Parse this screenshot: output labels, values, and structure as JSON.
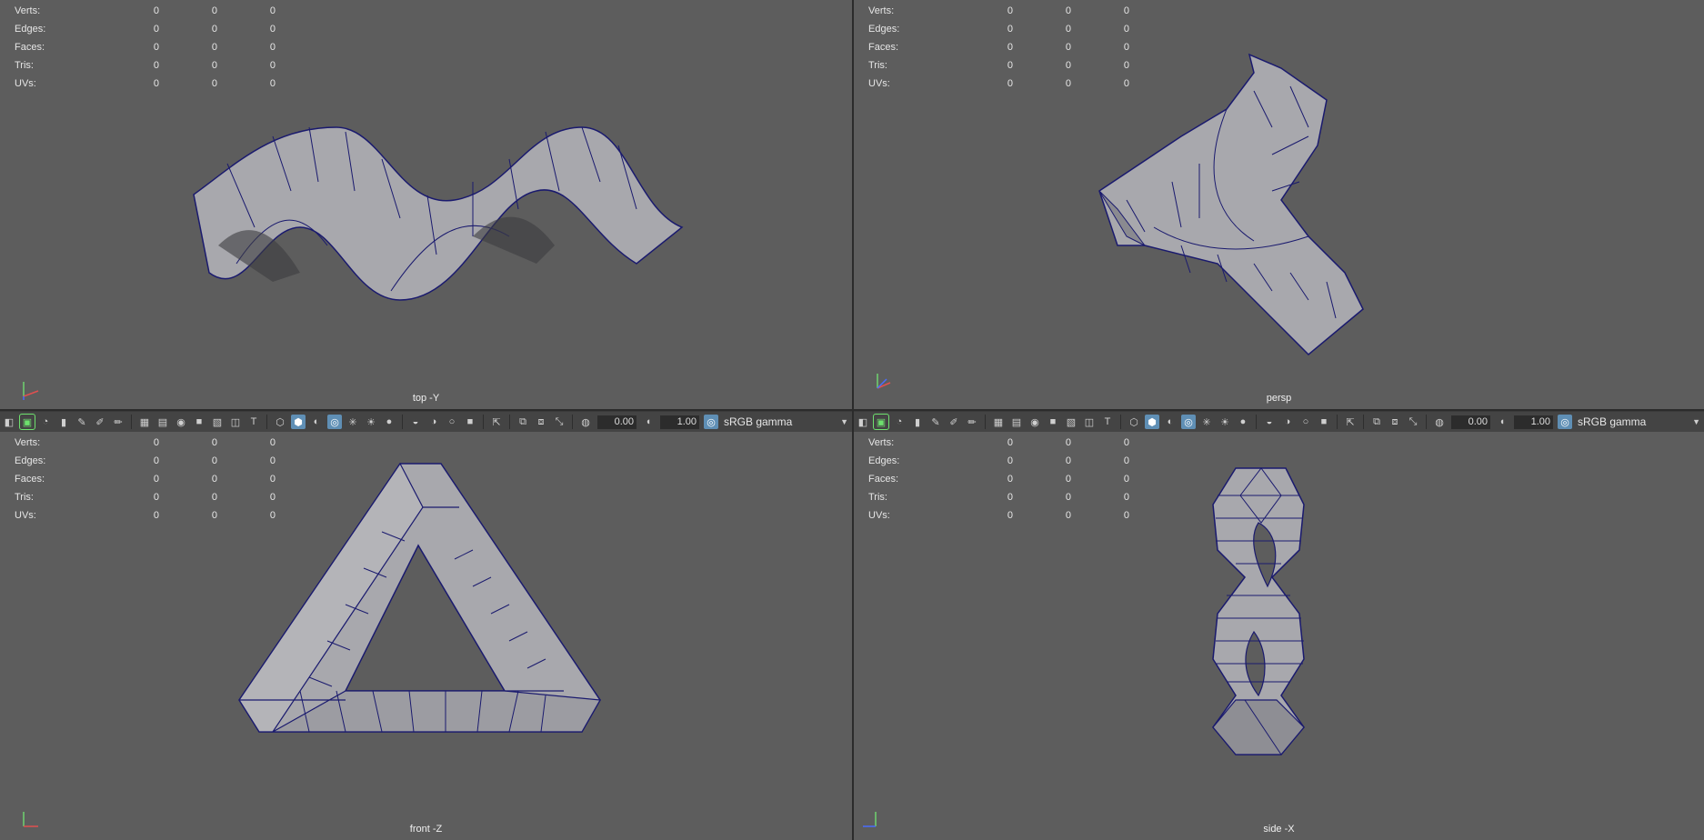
{
  "hud_labels": [
    "Verts:",
    "Edges:",
    "Faces:",
    "Tris:",
    "UVs:"
  ],
  "hud_values": [
    "0",
    "0",
    "0"
  ],
  "viewports": [
    {
      "name": "top -Y"
    },
    {
      "name": "persp"
    },
    {
      "name": "front -Z"
    },
    {
      "name": "side -X"
    }
  ],
  "toolbar": {
    "exposure": "0.00",
    "gamma": "1.00",
    "colorspace": "sRGB gamma"
  },
  "colors": {
    "viewport_bg": "#5d5d5d",
    "mesh_face": "#a8a8ad",
    "wireframe": "#1a1a6e",
    "toolbar_bg": "#444444",
    "active_icon": "#5f8fb5"
  },
  "icons": [
    "camera-icon",
    "select-camera-icon",
    "lock-camera-icon",
    "bookmark-icon",
    "pen-icon",
    "grid-icon",
    "film-gate-icon",
    "resolution-gate-icon",
    "wireframe-icon",
    "shaded-icon",
    "lighting-icon",
    "xray-icon",
    "isolate-icon",
    "colorspace-icon"
  ]
}
